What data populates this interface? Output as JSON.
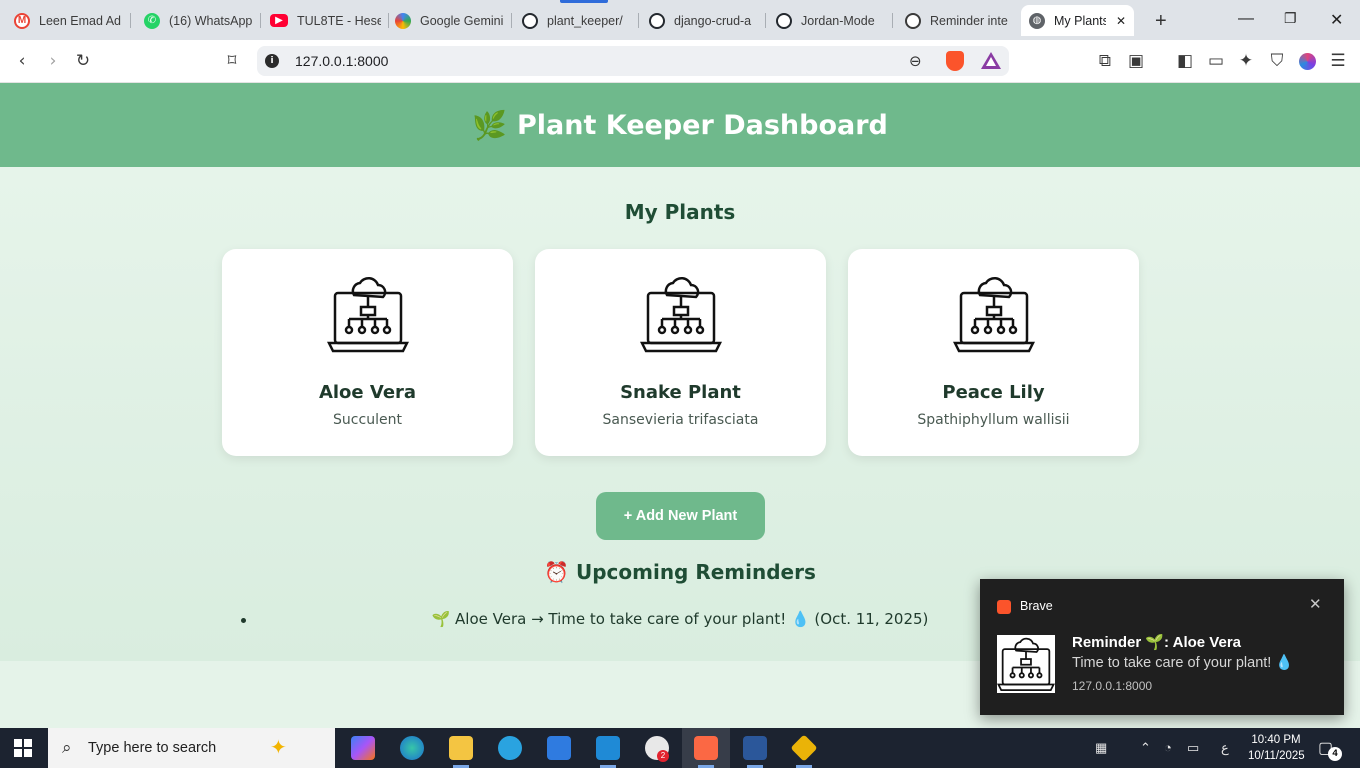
{
  "browser": {
    "tabs": [
      {
        "title": "Leen Emad Ad",
        "icon": "gmail-icon",
        "color": "#ea4335"
      },
      {
        "title": "(16) WhatsApp",
        "icon": "whatsapp-icon",
        "color": "#25d366"
      },
      {
        "title": "TUL8TE - Hese",
        "icon": "youtube-icon",
        "color": "#ff0033"
      },
      {
        "title": "Google Gemini",
        "icon": "gemini-icon",
        "color": "#4b7bec"
      },
      {
        "title": "plant_keeper/",
        "icon": "github-icon",
        "color": "#24292f"
      },
      {
        "title": "django-crud-a",
        "icon": "github-icon",
        "color": "#24292f"
      },
      {
        "title": "Jordan-Mode",
        "icon": "github-icon",
        "color": "#24292f"
      },
      {
        "title": "Reminder inte",
        "icon": "openai-icon",
        "color": "#3a3a3a"
      }
    ],
    "active_tab": {
      "title": "My Plants",
      "icon": "globe-icon"
    },
    "new_tab": "+",
    "address": "127.0.0.1:8000"
  },
  "app": {
    "header_icon": "🌿",
    "header_title": "Plant Keeper Dashboard",
    "plants_title": "My Plants",
    "plants": [
      {
        "name": "Aloe Vera",
        "species": "Succulent",
        "icon": "cloud-network-laptop-icon"
      },
      {
        "name": "Snake Plant",
        "species": "Sansevieria trifasciata",
        "icon": "cloud-network-laptop-icon"
      },
      {
        "name": "Peace Lily",
        "species": "Spathiphyllum wallisii",
        "icon": "cloud-network-laptop-icon"
      }
    ],
    "add_button": "+ Add New Plant",
    "reminders_icon": "⏰",
    "reminders_title": "Upcoming Reminders",
    "reminders": [
      {
        "text": "🌱 Aloe Vera → Time to take care of your plant! 💧 (Oct. 11, 2025)"
      }
    ]
  },
  "notification": {
    "app": "Brave",
    "title": "Reminder 🌱: Aloe Vera",
    "body": "Time to take care of your plant! 💧",
    "source": "127.0.0.1:8000",
    "close": "✕"
  },
  "taskbar": {
    "search_placeholder": "Type here to search",
    "clock_time": "10:40 PM",
    "clock_date": "10/11/2025",
    "lang": "ع",
    "notif_count": "4",
    "slack_badge": "2"
  }
}
